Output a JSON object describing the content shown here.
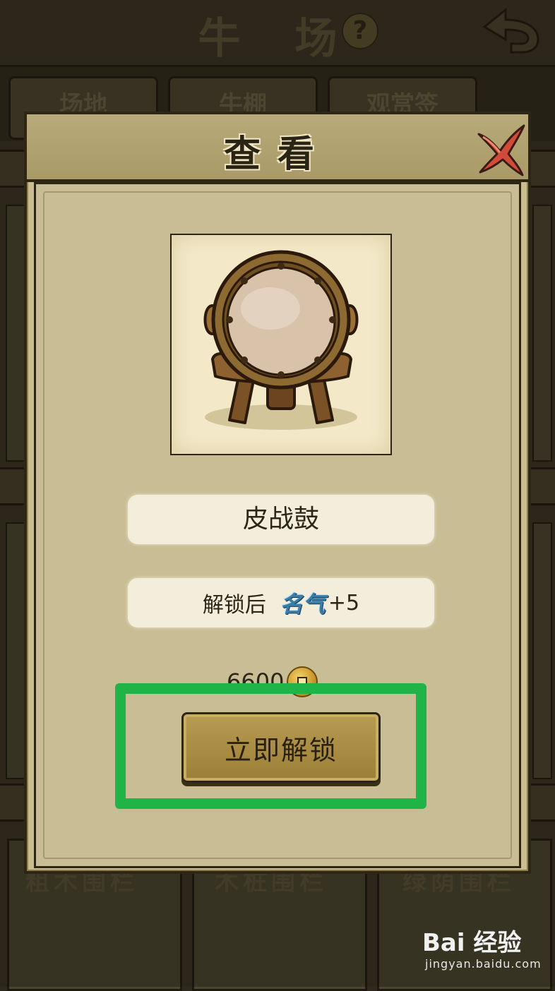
{
  "background": {
    "title": "牛 场",
    "tabs": [
      "场地",
      "牛棚",
      "观赏签"
    ],
    "card_labels": [
      "粗木围栏",
      "木桩围栏",
      "绿荫围栏"
    ]
  },
  "dialog": {
    "title": "查看",
    "item_name": "皮战鼓",
    "unlock_prefix": "解锁后",
    "fame_label": "名气",
    "fame_bonus": "+5",
    "price": "6600",
    "unlock_button": "立即解锁"
  },
  "watermark": {
    "brand": "Bai 经验",
    "url": "jingyan.baidu.com"
  },
  "colors": {
    "highlight": "#20b347",
    "dialog_bg": "#c9bd91",
    "button": "#a88b43"
  }
}
